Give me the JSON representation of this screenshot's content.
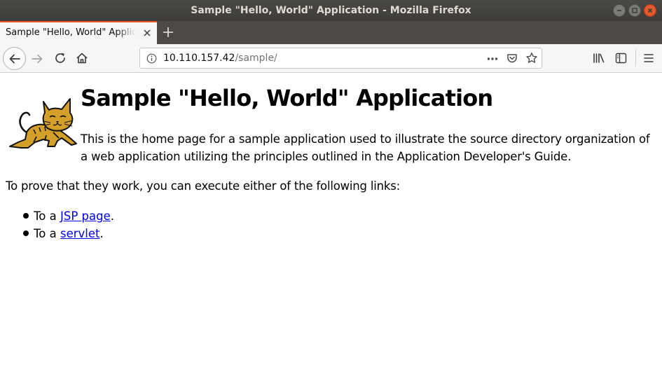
{
  "window": {
    "title": "Sample \"Hello, World\" Application - Mozilla Firefox"
  },
  "tab": {
    "title": "Sample \"Hello, World\" Application"
  },
  "urlbar": {
    "host": "10.110.157.42",
    "path": "/sample/"
  },
  "page": {
    "heading": "Sample \"Hello, World\" Application",
    "intro": "This is the home page for a sample application used to illustrate the source directory organization of a web application utilizing the principles outlined in the Application Developer's Guide.",
    "prove": "To prove that they work, you can execute either of the following links:",
    "links": [
      {
        "prefix": "To a ",
        "label": "JSP page",
        "suffix": "."
      },
      {
        "prefix": "To a ",
        "label": "servlet",
        "suffix": "."
      }
    ]
  },
  "colors": {
    "accent_tab": "#e95420",
    "link": "#0000ee",
    "titlebar": "#3d3c38"
  },
  "icons": [
    "minimize-icon",
    "maximize-icon",
    "close-icon",
    "tab-close-icon",
    "new-tab-icon",
    "back-icon",
    "forward-icon",
    "reload-icon",
    "home-icon",
    "site-info-icon",
    "page-actions-icon",
    "pocket-icon",
    "bookmark-star-icon",
    "library-icon",
    "sidebar-icon",
    "menu-icon",
    "tomcat-logo"
  ]
}
